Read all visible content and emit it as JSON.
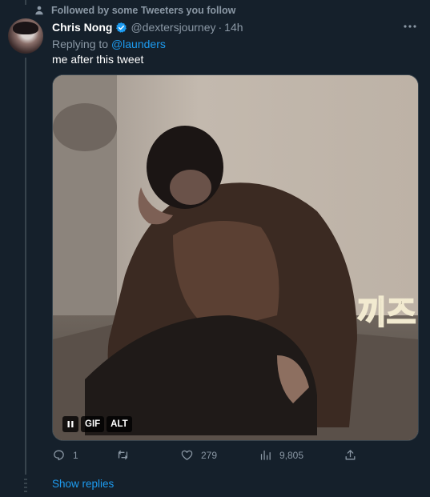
{
  "social_context": {
    "text": "Followed by some Tweeters you follow",
    "icon": "person-icon"
  },
  "tweet": {
    "author_name": "Chris Nong",
    "verified": true,
    "handle": "@dextersjourney",
    "separator": "·",
    "time": "14h",
    "replying_prefix": "Replying to ",
    "replying_to": "@launders",
    "text": "me after this tweet",
    "media": {
      "type": "GIF",
      "pause_label": "",
      "gif_label": "GIF",
      "alt_label": "ALT",
      "overlay_text": "끼즈"
    },
    "actions": {
      "replies": "1",
      "retweets": "",
      "likes": "279",
      "views": "9,805"
    }
  },
  "show_replies": "Show replies",
  "colors": {
    "background": "#15202b",
    "accent": "#1d9bf0",
    "secondary_text": "#8b98a5",
    "border": "#38444d"
  }
}
